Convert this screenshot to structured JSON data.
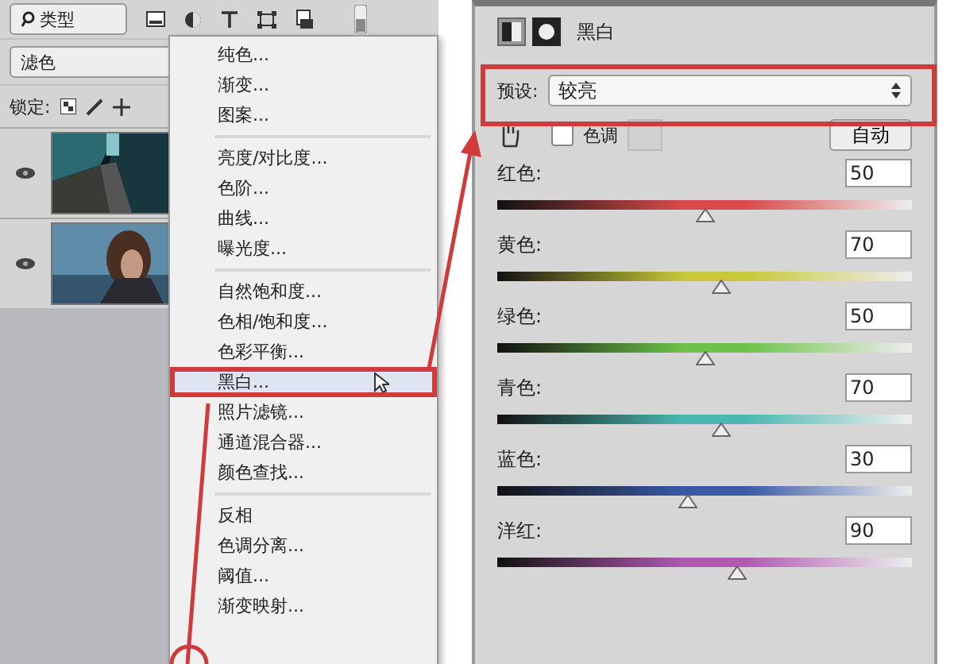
{
  "layers_panel": {
    "filter": "类型",
    "blend_mode": "滤色",
    "lock_label": "锁定:",
    "layers": [
      {
        "kind": "picture",
        "visible": true
      },
      {
        "kind": "picture",
        "visible": true
      }
    ]
  },
  "adjustment_menu": {
    "groups": [
      [
        {
          "label": "纯色...",
          "selected": false
        },
        {
          "label": "渐变...",
          "selected": false
        },
        {
          "label": "图案...",
          "selected": false
        }
      ],
      [
        {
          "label": "亮度/对比度...",
          "selected": false
        },
        {
          "label": "色阶...",
          "selected": false
        },
        {
          "label": "曲线...",
          "selected": false
        },
        {
          "label": "曝光度...",
          "selected": false
        }
      ],
      [
        {
          "label": "自然饱和度...",
          "selected": false
        },
        {
          "label": "色相/饱和度...",
          "selected": false
        },
        {
          "label": "色彩平衡...",
          "selected": false
        },
        {
          "label": "黑白...",
          "selected": true
        },
        {
          "label": "照片滤镜...",
          "selected": false
        },
        {
          "label": "通道混合器...",
          "selected": false
        },
        {
          "label": "颜色查找...",
          "selected": false
        }
      ],
      [
        {
          "label": "反相",
          "selected": false
        },
        {
          "label": "色调分离...",
          "selected": false
        },
        {
          "label": "阈值...",
          "selected": false
        },
        {
          "label": "渐变映射...",
          "selected": false
        }
      ]
    ]
  },
  "properties_panel": {
    "title": "黑白",
    "preset_label": "预设:",
    "preset": "较亮",
    "tint": {
      "label": "色调",
      "checked": false
    },
    "auto_button": "自动",
    "channels": [
      {
        "name": "红色:",
        "value": "50",
        "level": 0.5,
        "color": "#d84a4a"
      },
      {
        "name": "黄色:",
        "value": "70",
        "level": 0.54,
        "color": "#c8c83a"
      },
      {
        "name": "绿色:",
        "value": "50",
        "level": 0.5,
        "color": "#6ec24a"
      },
      {
        "name": "青色:",
        "value": "70",
        "level": 0.54,
        "color": "#4ab8b0"
      },
      {
        "name": "蓝色:",
        "value": "30",
        "level": 0.46,
        "color": "#3a5aa8"
      },
      {
        "name": "洋红:",
        "value": "90",
        "level": 0.58,
        "color": "#b05ab0"
      }
    ]
  }
}
